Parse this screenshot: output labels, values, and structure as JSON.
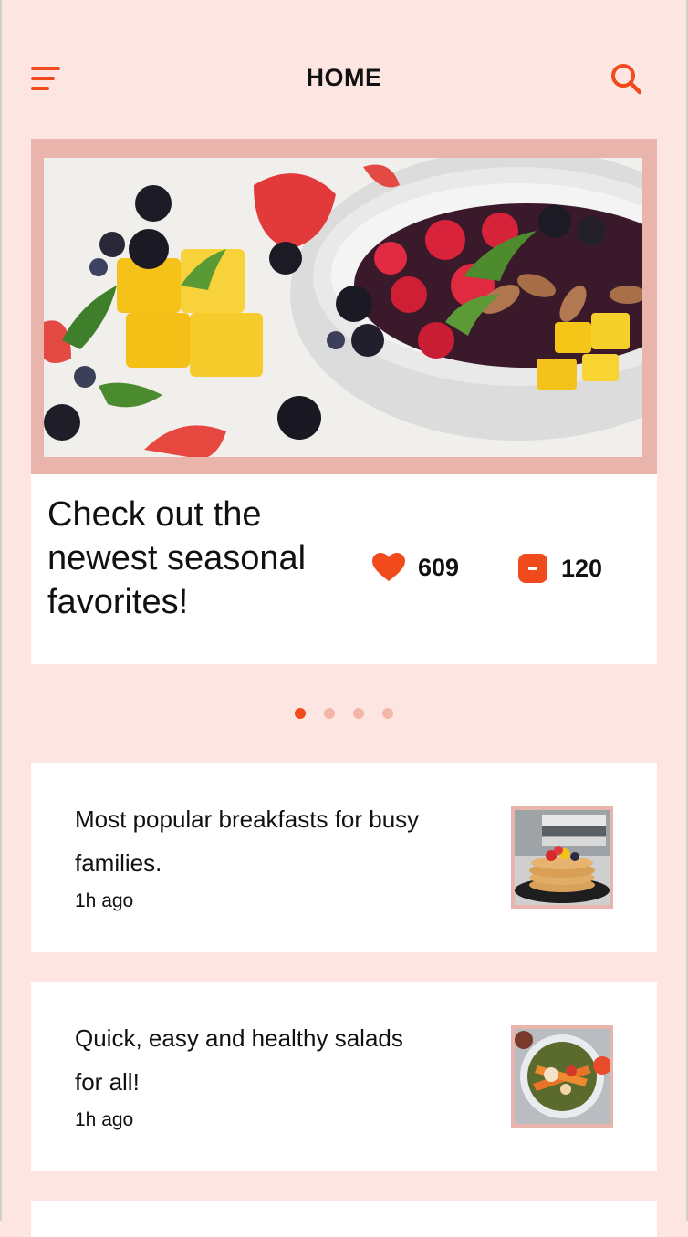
{
  "header": {
    "title": "HOME",
    "menu_icon": "hamburger-menu-icon",
    "search_icon": "search-icon"
  },
  "hero": {
    "headline": "Check out the newest seasonal favorites!",
    "image": "fruit-bowl-photo",
    "likes": "609",
    "comments": "120",
    "like_icon": "heart-icon",
    "comment_icon": "comment-icon"
  },
  "carousel": {
    "total": 4,
    "active_index": 0
  },
  "articles": [
    {
      "title": "Most popular breakfasts for busy families.",
      "time": "1h ago",
      "image": "pancakes-photo"
    },
    {
      "title": "Quick, easy and healthy salads for all!",
      "time": "1h ago",
      "image": "salad-photo"
    }
  ],
  "colors": {
    "accent": "#f04a1d",
    "background": "#fde6e1",
    "image_frame": "#e8b4ab",
    "dot_inactive": "#f3b7a8"
  }
}
